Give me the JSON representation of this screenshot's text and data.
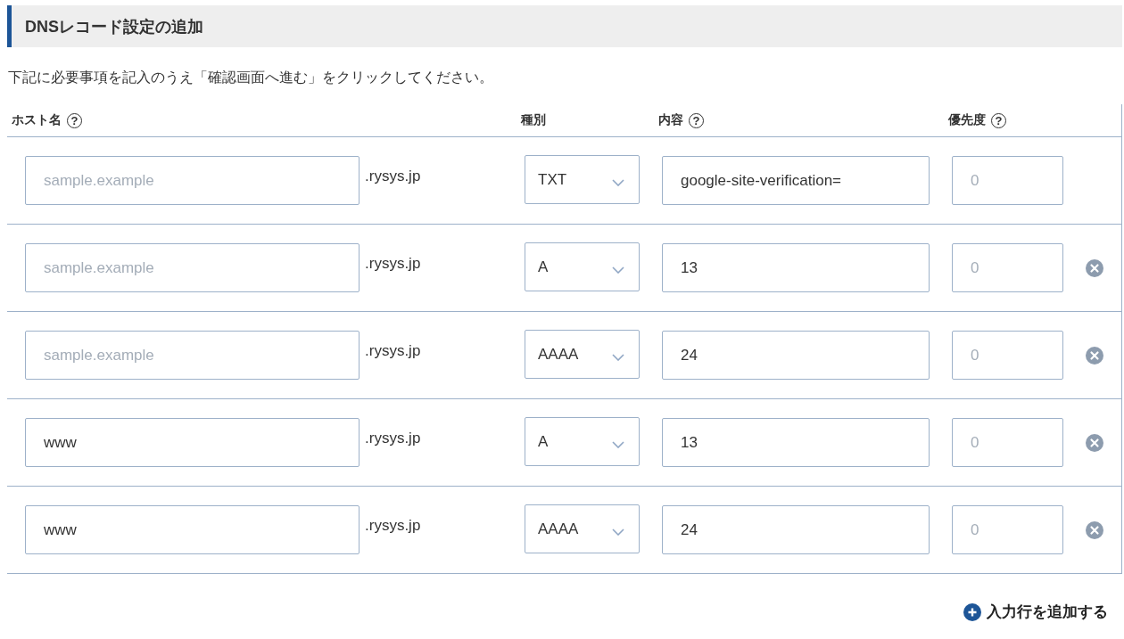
{
  "section": {
    "title": "DNSレコード設定の追加"
  },
  "description": "下記に必要事項を記入のうえ「確認画面へ進む」をクリックしてください。",
  "columns": [
    {
      "label": "ホスト名",
      "help": "?"
    },
    {
      "label": "種別"
    },
    {
      "label": "内容",
      "help": "?"
    },
    {
      "label": "優先度",
      "help": "?"
    }
  ],
  "rows": [
    {
      "host": {
        "placeholder": "sample.example"
      },
      "suffix": ".rysys.jp",
      "type": "TXT",
      "content": {
        "value": "google-site-verification="
      },
      "priority": {
        "placeholder": "0"
      },
      "removable": false
    },
    {
      "host": {
        "placeholder": "sample.example"
      },
      "suffix": ".rysys.jp",
      "type": "A",
      "content": {
        "value": "13"
      },
      "priority": {
        "placeholder": "0"
      },
      "removable": true
    },
    {
      "host": {
        "placeholder": "sample.example"
      },
      "suffix": ".rysys.jp",
      "type": "AAAA",
      "content": {
        "value": "24"
      },
      "priority": {
        "placeholder": "0"
      },
      "removable": true
    },
    {
      "host": {
        "value": "www"
      },
      "suffix": ".rysys.jp",
      "type": "A",
      "content": {
        "value": "13"
      },
      "priority": {
        "placeholder": "0"
      },
      "removable": true
    },
    {
      "host": {
        "value": "www"
      },
      "suffix": ".rysys.jp",
      "type": "AAAA",
      "content": {
        "value": "24"
      },
      "priority": {
        "placeholder": "0"
      },
      "removable": true
    }
  ],
  "add_button": {
    "label": "入力行を追加する"
  }
}
